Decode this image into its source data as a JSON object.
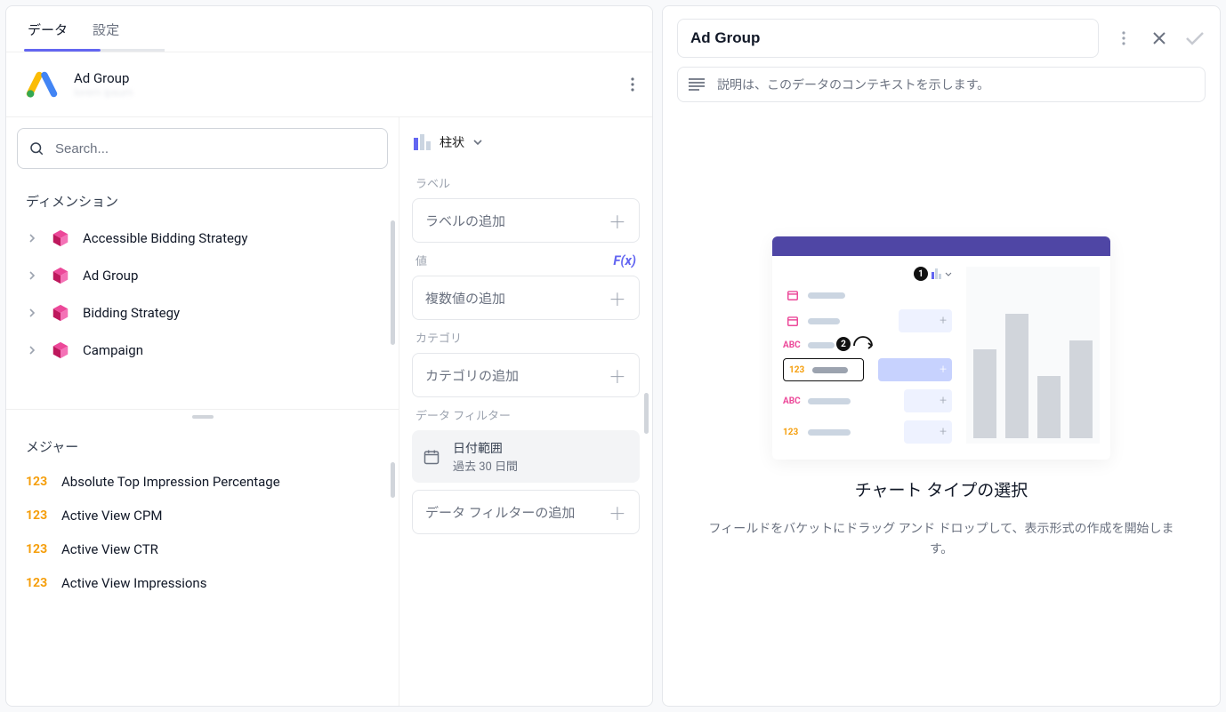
{
  "tabs": {
    "data": "データ",
    "settings": "設定"
  },
  "data_source": {
    "title": "Ad Group"
  },
  "search": {
    "placeholder": "Search..."
  },
  "dimensions": {
    "title": "ディメンション",
    "items": [
      {
        "label": "Accessible Bidding Strategy"
      },
      {
        "label": "Ad Group"
      },
      {
        "label": "Bidding Strategy"
      },
      {
        "label": "Campaign"
      }
    ]
  },
  "measures": {
    "title": "メジャー",
    "badge": "123",
    "items": [
      {
        "label": "Absolute Top Impression Percentage"
      },
      {
        "label": "Active View CPM"
      },
      {
        "label": "Active View CTR"
      },
      {
        "label": "Active View Impressions"
      }
    ]
  },
  "viz": {
    "type_label": "柱状"
  },
  "config": {
    "label_title": "ラベル",
    "label_placeholder": "ラベルの追加",
    "value_title": "値",
    "value_placeholder": "複数値の追加",
    "category_title": "カテゴリ",
    "category_placeholder": "カテゴリの追加",
    "filter_title": "データ フィルター",
    "date_range_title": "日付範囲",
    "date_range_value": "過去 30 日間",
    "filter_placeholder": "データ フィルターの追加",
    "fx": "F(x)"
  },
  "right": {
    "title": "Ad Group",
    "description_placeholder": "説明は、このデータのコンテキストを示します。",
    "placeholder_title": "チャート タイプの選択",
    "placeholder_text": "フィールドをバケットにドラッグ アンド ドロップして、表示形式の作成を開始します。",
    "ph_tags": {
      "abc": "ABC",
      "num": "123"
    }
  }
}
